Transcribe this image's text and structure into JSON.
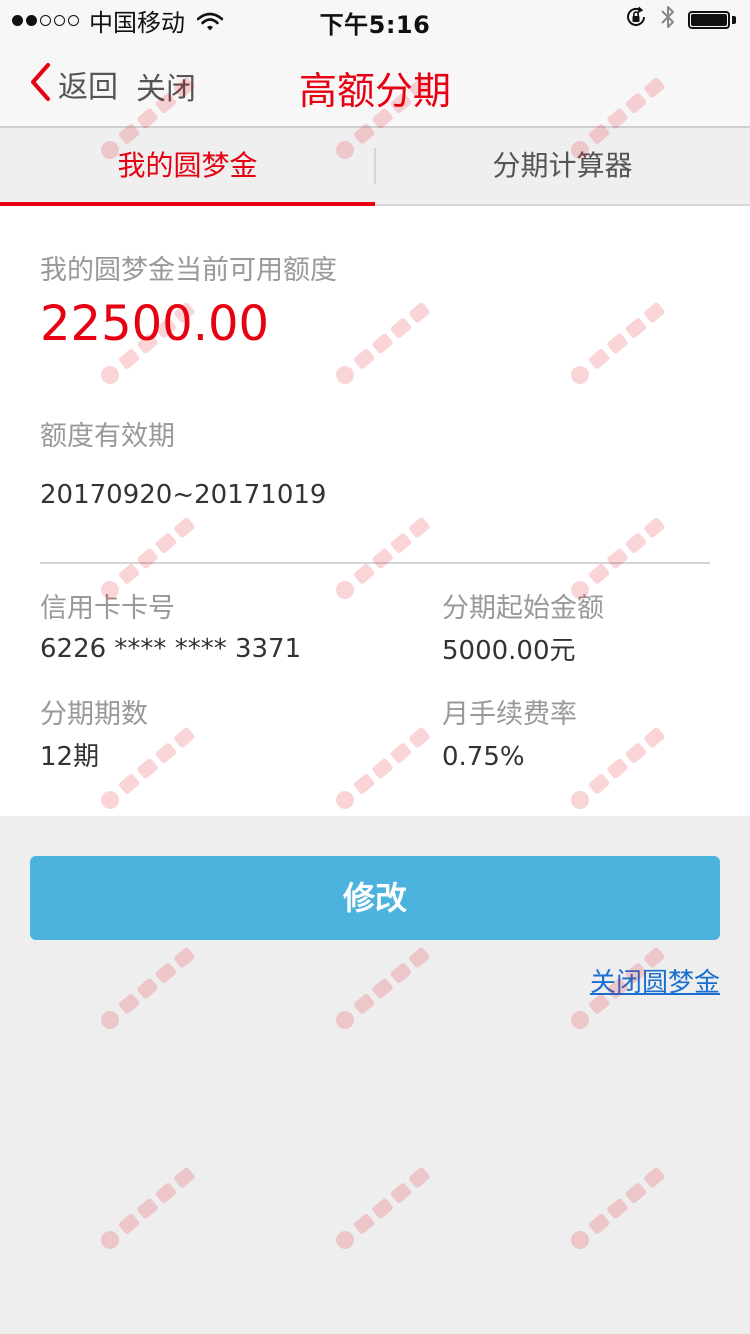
{
  "status_bar": {
    "carrier": "中国移动",
    "time": "下午5:16",
    "signal_dots": [
      "filled",
      "filled",
      "empty",
      "empty",
      "empty"
    ]
  },
  "nav": {
    "back_label": "返回",
    "close_label": "关闭",
    "title": "高额分期"
  },
  "tabs": [
    {
      "label": "我的圆梦金",
      "active": true
    },
    {
      "label": "分期计算器",
      "active": false
    }
  ],
  "card": {
    "limit_label": "我的圆梦金当前可用额度",
    "limit_amount": "22500.00",
    "validity_label": "额度有效期",
    "validity_value": "20170920~20171019",
    "card_number_label": "信用卡卡号",
    "card_number_value": "6226 **** **** 3371",
    "min_amount_label": "分期起始金额",
    "min_amount_value": "5000.00元",
    "terms_label": "分期期数",
    "terms_value": "12期",
    "fee_rate_label": "月手续费率",
    "fee_rate_value": "0.75%"
  },
  "actions": {
    "modify_label": "修改",
    "close_link_label": "关闭圆梦金"
  },
  "colors": {
    "accent_red": "#e60012",
    "button_blue": "#4bb3de",
    "link_blue": "#1a6fd1"
  }
}
